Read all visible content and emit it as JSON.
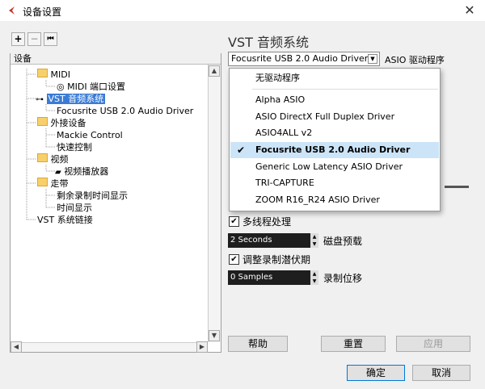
{
  "window": {
    "title": "设备设置",
    "close": "✕"
  },
  "toolbar": {
    "add": "+",
    "remove": "−",
    "reset": "⏮"
  },
  "tree": {
    "header": "设备",
    "items": [
      {
        "label": "MIDI",
        "icon": "folder"
      },
      {
        "label": "MIDI 端口设置",
        "icon": "midi-port"
      },
      {
        "label": "VST 音频系统",
        "icon": "vst",
        "selected": true
      },
      {
        "label": "Focusrite USB 2.0 Audio Driver",
        "icon": ""
      },
      {
        "label": "外接设备",
        "icon": "folder"
      },
      {
        "label": "Mackie Control",
        "icon": ""
      },
      {
        "label": "快速控制",
        "icon": ""
      },
      {
        "label": "视频",
        "icon": "folder"
      },
      {
        "label": "视频播放器",
        "icon": "video"
      },
      {
        "label": "走带",
        "icon": "folder"
      },
      {
        "label": "剩余录制时间显示",
        "icon": ""
      },
      {
        "label": "时间显示",
        "icon": ""
      },
      {
        "label": "VST 系统链接",
        "icon": ""
      }
    ]
  },
  "panel": {
    "title": "VST 音频系统",
    "driver_value": "Focusrite USB 2.0 Audio Driver",
    "driver_label": "ASIO 驱动程序",
    "dropdown": [
      "无驱动程序",
      "Alpha ASIO",
      "ASIO DirectX Full Duplex Driver",
      "ASIO4ALL v2",
      "Focusrite USB 2.0 Audio Driver",
      "Generic Low Latency ASIO Driver",
      "TRI-CAPTURE",
      "ZOOM R16_R24 ASIO Driver"
    ],
    "dropdown_selected": "Focusrite USB 2.0 Audio Driver",
    "multithread_label": "多线程处理",
    "disk_preload_value": "2 Seconds",
    "disk_preload_label": "磁盘预载",
    "adjust_latency_label": "调整录制潜伏期",
    "record_shift_value": "0 Samples",
    "record_shift_label": "录制位移"
  },
  "buttons": {
    "help": "帮助",
    "reset": "重置",
    "apply": "应用",
    "ok": "确定",
    "cancel": "取消"
  },
  "colors": {
    "selection": "#3a7bd5",
    "dropdown_highlight": "#cce4f7"
  }
}
